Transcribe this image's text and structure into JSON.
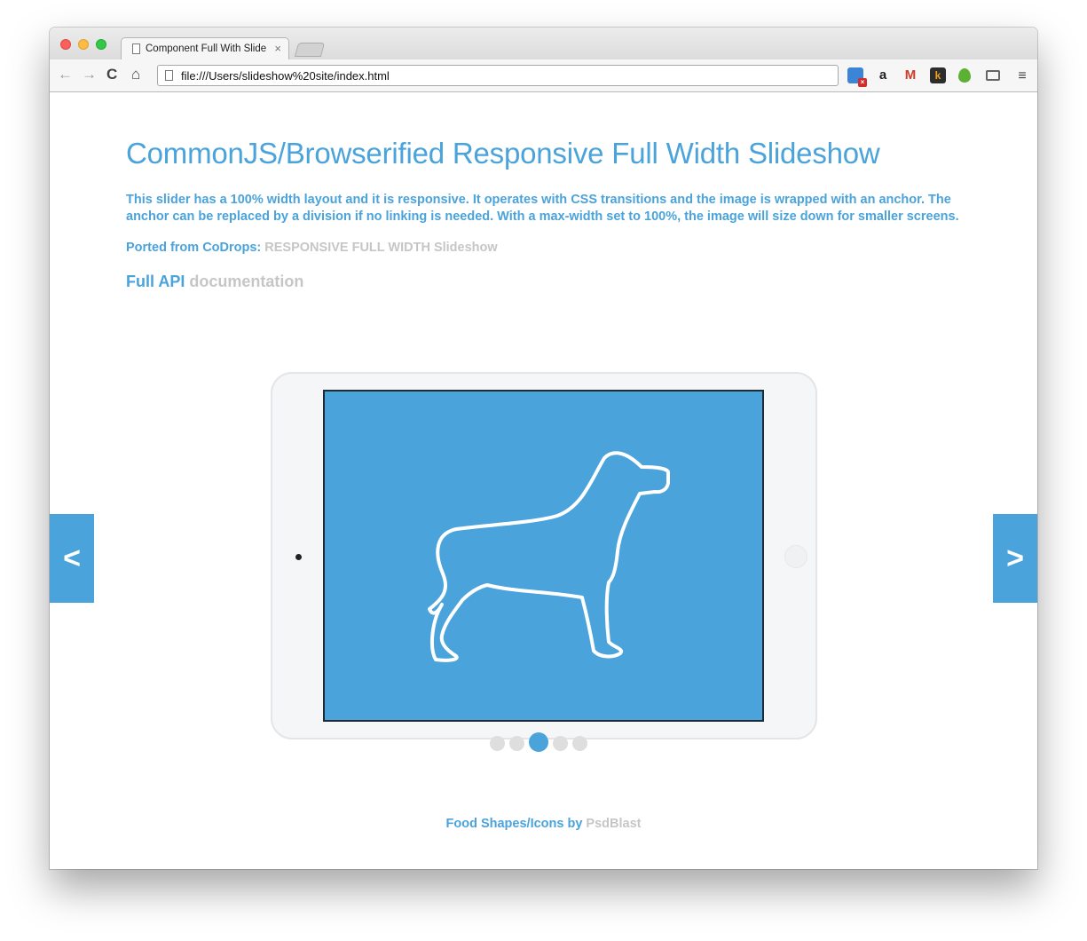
{
  "browser": {
    "tab_title": "Component Full With Slideshow",
    "tab_close": "×",
    "url": "file:///Users/slideshow%20site/index.html",
    "icons": {
      "back": "←",
      "forward": "→",
      "reload": "C",
      "home": "⌂",
      "amazon": "a",
      "mail": "M",
      "k": "k",
      "cal_badge": "×",
      "menu": "≡"
    }
  },
  "page": {
    "title": "CommonJS/Browserified Responsive Full Width Slideshow",
    "description": "This slider has a 100% width layout and it is responsive. It operates with CSS transitions and the image is wrapped with an anchor. The anchor can be replaced by a division if no linking is needed. With a max-width set to 100%, the image will size down for smaller screens.",
    "ported_label": "Ported from CoDrops:",
    "ported_link": "RESPONSIVE FULL WIDTH Slideshow",
    "api_label": "Full API",
    "api_link": "documentation"
  },
  "slideshow": {
    "prev_label": "<",
    "next_label": ">",
    "dot_count": 5,
    "active_index": 2
  },
  "footer": {
    "label": "Food Shapes/Icons by",
    "link": "PsdBlast"
  },
  "colors": {
    "accent": "#4aa3db",
    "muted": "#c6c6c6",
    "dot": "#dedede"
  }
}
